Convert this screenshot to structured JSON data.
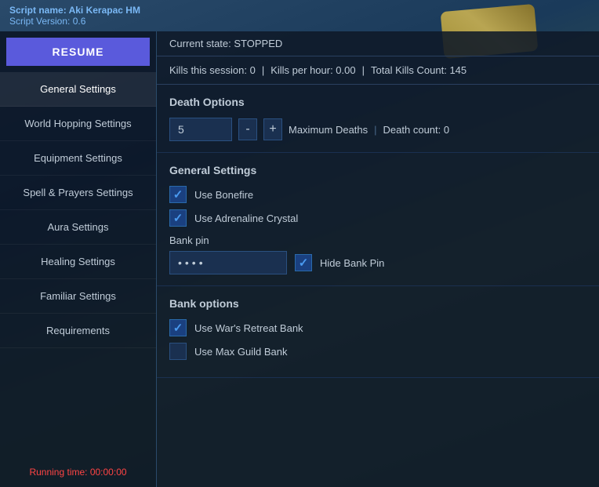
{
  "script": {
    "name_label": "Script name: Aki Kerapac HM",
    "version_label": "Script Version: 0.6"
  },
  "header": {
    "resume_label": "RESUME",
    "status_label": "Current state: STOPPED"
  },
  "stats": {
    "kills_session_label": "Kills this session: 0",
    "kills_per_hour_label": "Kills per hour: 0.00",
    "total_kills_label": "Total Kills Count: 145",
    "sep1": "|",
    "sep2": "|"
  },
  "sidebar": {
    "items": [
      {
        "id": "general-settings",
        "label": "General Settings"
      },
      {
        "id": "world-hopping-settings",
        "label": "World Hopping Settings"
      },
      {
        "id": "equipment-settings",
        "label": "Equipment Settings"
      },
      {
        "id": "spell-prayers-settings",
        "label": "Spell & Prayers Settings"
      },
      {
        "id": "aura-settings",
        "label": "Aura Settings"
      },
      {
        "id": "healing-settings",
        "label": "Healing Settings"
      },
      {
        "id": "familiar-settings",
        "label": "Familiar Settings"
      },
      {
        "id": "requirements",
        "label": "Requirements"
      }
    ],
    "running_time_label": "Running time: 00:00:00"
  },
  "death_options": {
    "title": "Death Options",
    "max_deaths_value": "5",
    "minus_label": "-",
    "plus_label": "+",
    "max_deaths_label": "Maximum Deaths",
    "separator": "|",
    "death_count_label": "Death count: 0"
  },
  "general_settings": {
    "title": "General Settings",
    "use_bonefire_label": "Use Bonefire",
    "use_bonefire_checked": true,
    "use_adrenaline_crystal_label": "Use Adrenaline Crystal",
    "use_adrenaline_crystal_checked": true
  },
  "bank_pin": {
    "field_label": "Bank pin",
    "pin_value": "****",
    "hide_pin_label": "Hide Bank Pin",
    "hide_pin_checked": true
  },
  "bank_options": {
    "title": "Bank options",
    "use_wars_retreat_label": "Use War's Retreat Bank",
    "use_wars_retreat_checked": true,
    "use_max_guild_label": "Use Max Guild Bank",
    "use_max_guild_checked": false
  }
}
